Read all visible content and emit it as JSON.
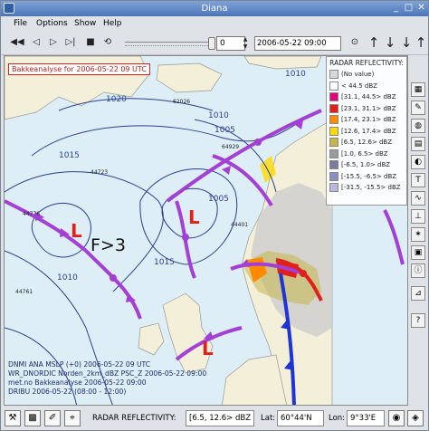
{
  "window": {
    "title": "Diana"
  },
  "menu": [
    {
      "label": "File"
    },
    {
      "label": "Options"
    },
    {
      "label": "Show"
    },
    {
      "label": "Help"
    }
  ],
  "toolbar": {
    "spin_value": "0",
    "datetime": "2006-05-22 09:00"
  },
  "map": {
    "top_label": "Bakkeanalyse for 2006-05-22 09 UTC",
    "annotation": "F>3",
    "low_symbol": "L",
    "isobars": [
      "1020",
      "1015",
      "1010",
      "1005",
      "1010",
      "1015",
      "1005",
      "1010"
    ],
    "stations": [
      "44723",
      "44776",
      "44761",
      "64929",
      "44401",
      "62026"
    ],
    "info_lines": [
      "DNMI ANA MSLP (+0) 2006-05-22 09 UTC",
      "WR_DNORDIC Norden_2km_dBZ PSC_Z 2006-05-22 09:00",
      "met.no Bakkeanalyse 2006-05-22 09:00",
      "DRIBU 2006-05-22 (08:00 - 12:00)"
    ],
    "colors": {
      "sea": "#ddeef7",
      "land": "#f3efd9",
      "isobar": "#2b3f8f",
      "front_purple": "#a43fd6",
      "front_blue": "#1f34d8",
      "front_red": "#e0201a"
    }
  },
  "legend": {
    "title": "RADAR REFLECTIVITY:",
    "items": [
      {
        "label": "(No value)",
        "color": "#d9d9d9"
      },
      {
        "label": "< 44.5 dBZ",
        "color": "#ffffff"
      },
      {
        "label": "[31.1, 44.5> dBZ",
        "color": "#e3007a"
      },
      {
        "label": "[23.1, 31.1> dBZ",
        "color": "#e0201a"
      },
      {
        "label": "[17.4, 23.1> dBZ",
        "color": "#ff8a00"
      },
      {
        "label": "[12.6, 17.4> dBZ",
        "color": "#ffd800"
      },
      {
        "label": "[6.5, 12.6> dBZ",
        "color": "#c4b44a"
      },
      {
        "label": "[1.0, 6.5> dBZ",
        "color": "#9b9b9b"
      },
      {
        "label": "[-6.5, 1.0> dBZ",
        "color": "#7b7b9c"
      },
      {
        "label": "[-15.5, -6.5> dBZ",
        "color": "#8e8ec6"
      },
      {
        "label": "[-31.5, -15.5> dBZ",
        "color": "#b9b9e0"
      }
    ]
  },
  "status": {
    "label": "RADAR REFLECTIVITY:",
    "value": "[6.5, 12.6> dBZ",
    "lat_label": "Lat:",
    "lat_value": "60°44'N",
    "lon_label": "Lon:",
    "lon_value": "9°33'E"
  }
}
